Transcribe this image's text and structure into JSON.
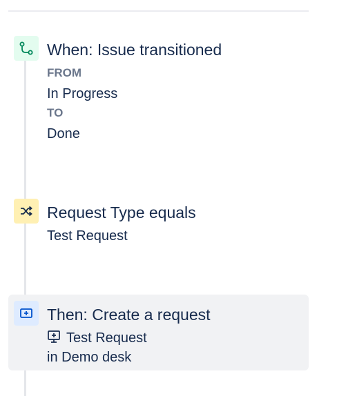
{
  "trigger": {
    "icon": "transition-icon",
    "title": "When: Issue transitioned",
    "from_label": "FROM",
    "from_value": "In Progress",
    "to_label": "TO",
    "to_value": "Done"
  },
  "condition": {
    "icon": "shuffle-icon",
    "title": "Request Type equals",
    "value": "Test Request"
  },
  "action": {
    "icon": "create-request-icon",
    "title": "Then: Create a request",
    "request_icon": "request-type-icon",
    "request_type": "Test Request",
    "project": "in Demo desk"
  },
  "colors": {
    "trigger_bg": "#e3fcef",
    "trigger_fg": "#00875a",
    "condition_bg": "#fff0b3",
    "condition_fg": "#172b4d",
    "action_bg": "#deebff",
    "action_fg": "#0052cc",
    "active_row_bg": "#f1f2f4"
  }
}
